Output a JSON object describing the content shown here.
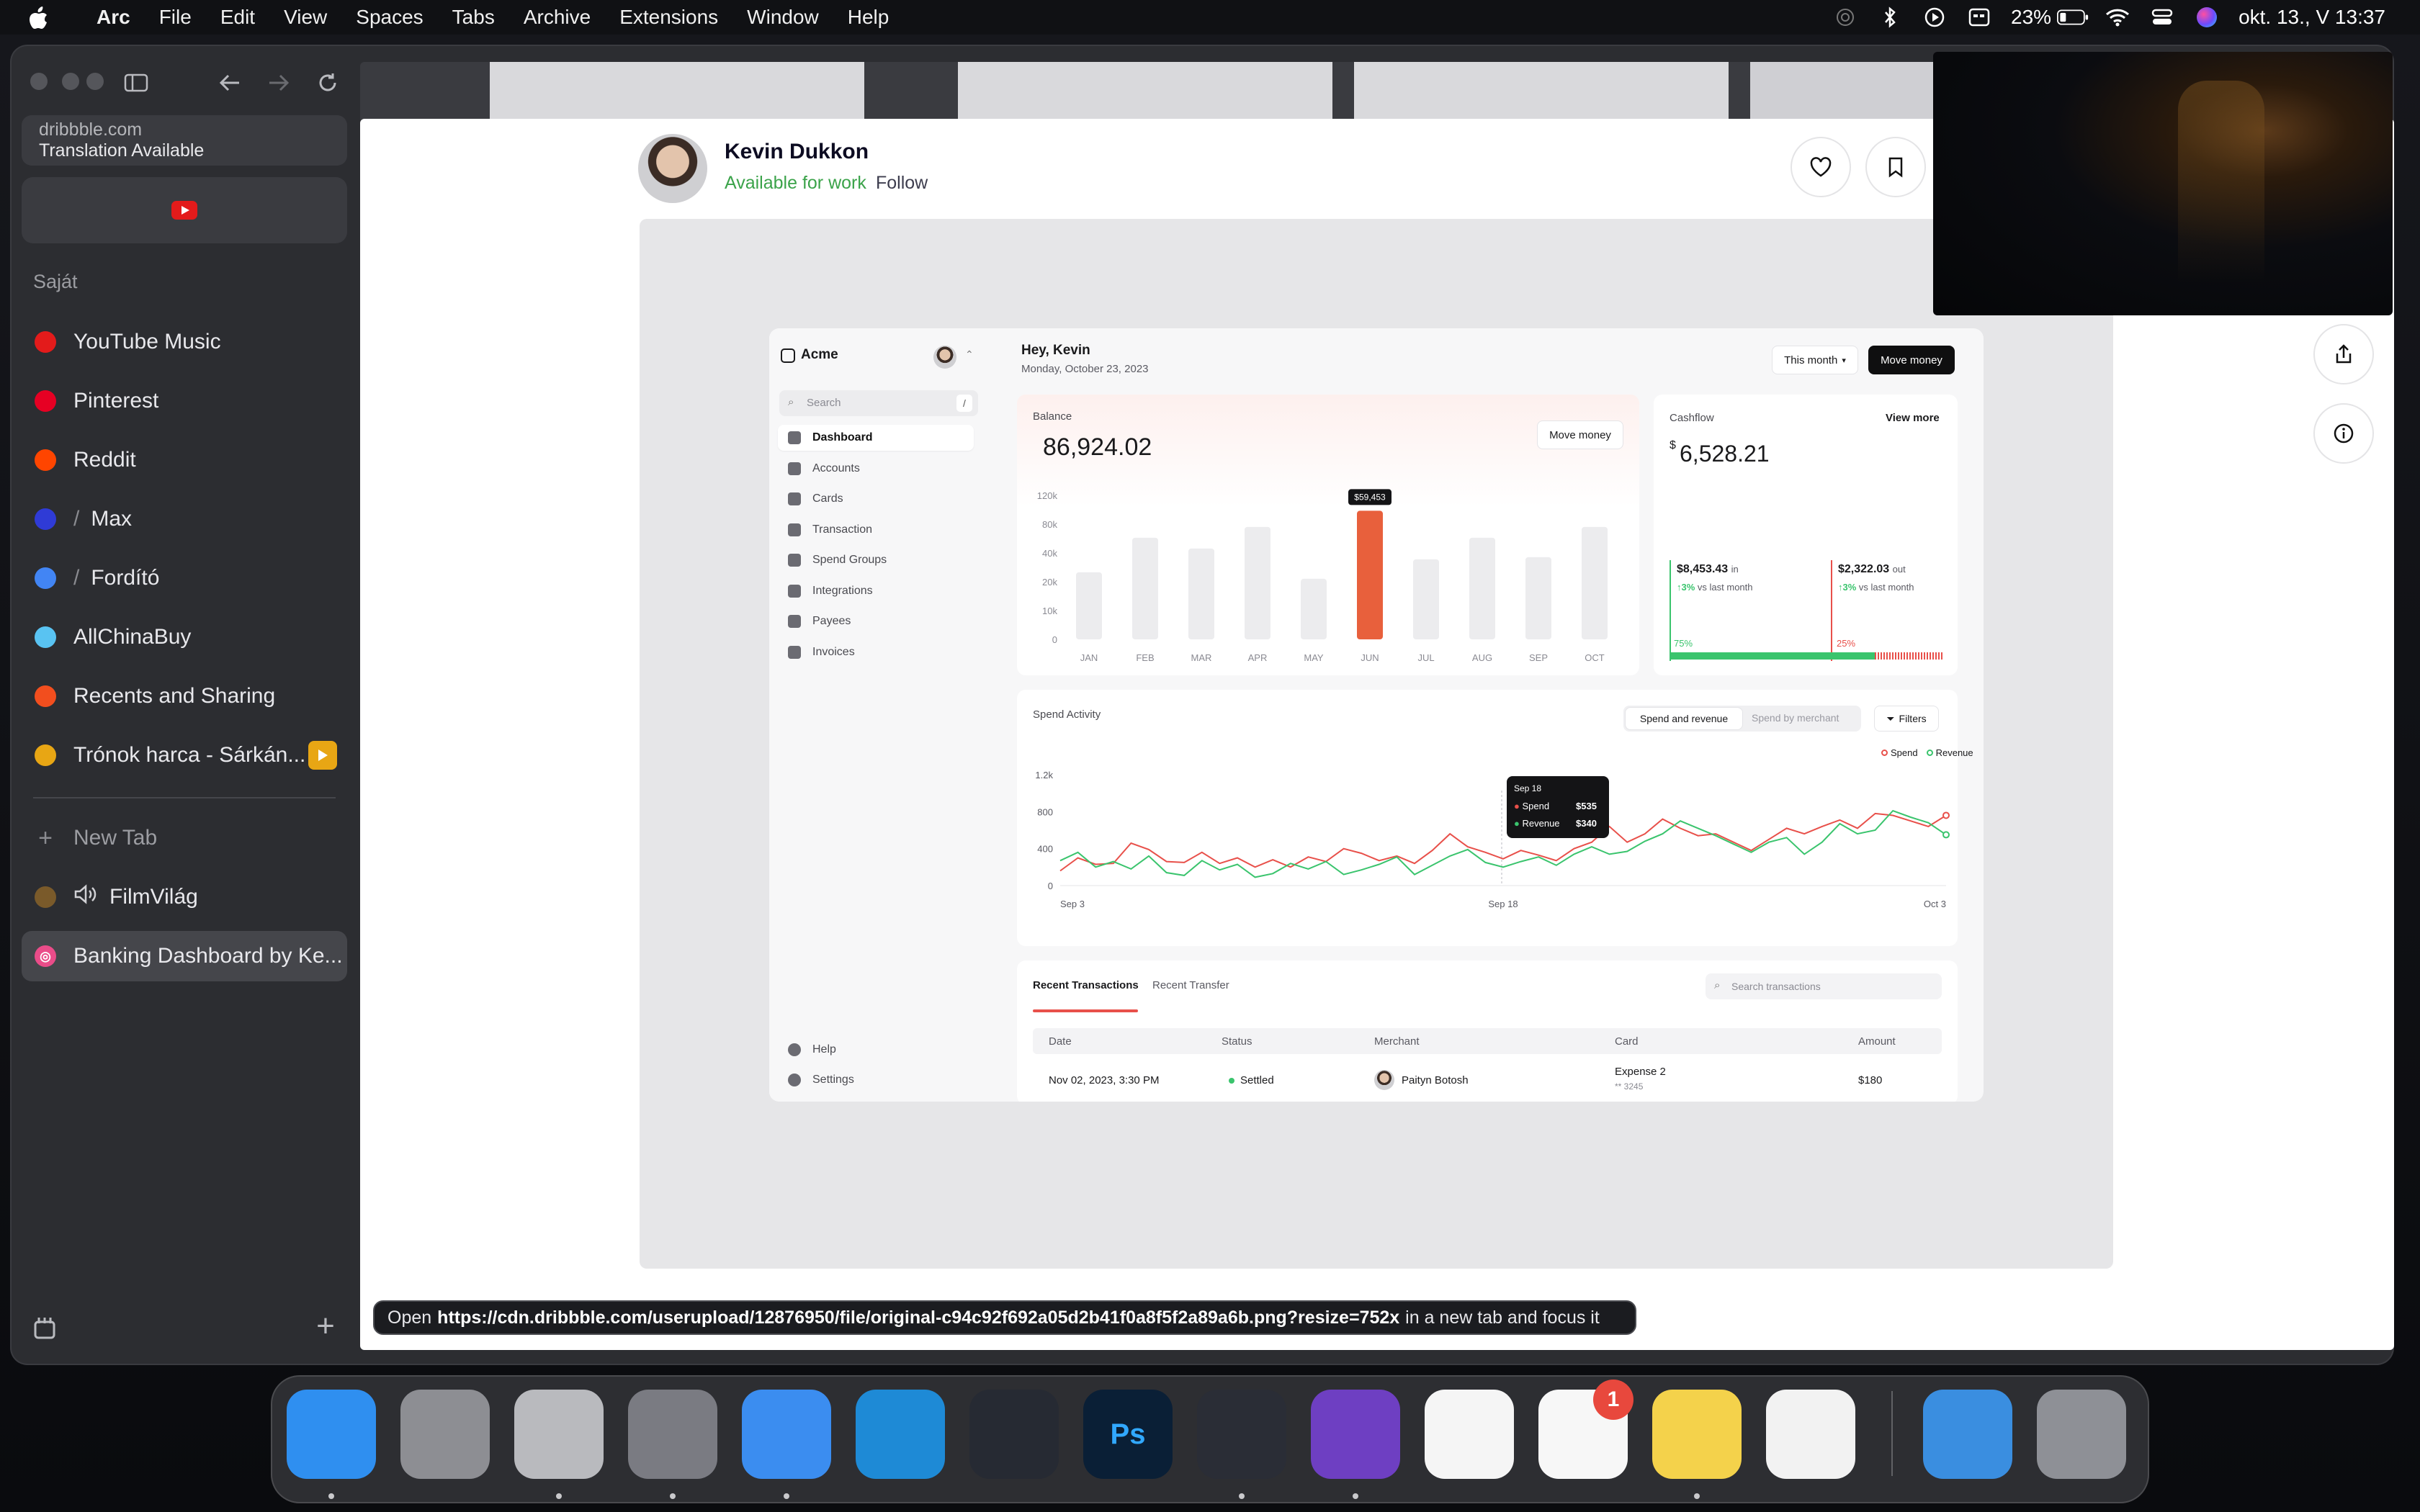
{
  "menubar": {
    "app_name": "Arc",
    "items": [
      "File",
      "Edit",
      "View",
      "Spaces",
      "Tabs",
      "Archive",
      "Extensions",
      "Window",
      "Help"
    ],
    "battery": "23%",
    "clock": "okt. 13., V  13:37"
  },
  "browser": {
    "url_domain": "dribbble.com",
    "url_notice": "Translation Available",
    "section_label": "Saját",
    "tabs": [
      {
        "label": "YouTube Music",
        "icon": "youtube-music-icon",
        "color": "#e31b1b"
      },
      {
        "label": "Pinterest",
        "icon": "pinterest-icon",
        "color": "#e60023"
      },
      {
        "label": "Reddit",
        "icon": "reddit-icon",
        "color": "#ff4500"
      },
      {
        "label": "Max",
        "icon": "max-icon",
        "color": "#2f3bd6"
      },
      {
        "label": "Fordító",
        "icon": "translate-icon",
        "color": "#4285f4"
      },
      {
        "label": "AllChinaBuy",
        "icon": "allchinabuy-icon",
        "color": "#59c3f2"
      },
      {
        "label": "Recents and Sharing",
        "icon": "figma-icon",
        "color": "#f24e1e"
      },
      {
        "label": "Trónok harca - Sárkán...",
        "icon": "play-icon",
        "color": "#e8a614"
      }
    ],
    "new_tab_label": "New Tab",
    "extra_tabs": [
      {
        "label": "FilmVilág",
        "icon": "filmvilag-icon"
      },
      {
        "label": "Banking Dashboard by Ke...",
        "icon": "dribbble-icon",
        "color": "#ea4c89"
      }
    ],
    "status_prefix": "Open",
    "status_url": "https://cdn.dribbble.com/userupload/12876950/file/original-c94c92f692a05d2b41f0a8f5f2a89a6b.png?resize=752x",
    "status_suffix": "in a new tab and focus it"
  },
  "shot": {
    "author": "Kevin Dukkon",
    "availability": "Available for work",
    "follow_label": "Follow"
  },
  "dashboard": {
    "brand": "Acme",
    "search_placeholder": "Search",
    "search_shortcut": "/",
    "nav": [
      "Dashboard",
      "Accounts",
      "Cards",
      "Transaction",
      "Spend Groups",
      "Integrations",
      "Payees",
      "Invoices"
    ],
    "nav_bottom": [
      "Help",
      "Settings"
    ],
    "greeting": "Hey, Kevin",
    "date": "Monday, October 23, 2023",
    "period_label": "This month",
    "move_money_label": "Move money",
    "balance": {
      "label": "Balance",
      "value": "86,924.02",
      "button": "Move money",
      "tooltip": "$59,453"
    },
    "cashflow": {
      "label": "Cashflow",
      "view_more": "View more",
      "currency": "$",
      "value": "6,528.21",
      "in_value": "$8,453.43",
      "in_label": "in",
      "in_change": "3%",
      "in_change_label": "vs last month",
      "out_value": "$2,322.03",
      "out_label": "out",
      "out_change": "3%",
      "out_change_label": "vs last month",
      "in_pct": "75%",
      "out_pct": "25%",
      "in_fraction": 0.75,
      "out_fraction": 0.25,
      "in_color": "#3ac46d",
      "out_color": "#e8504a"
    },
    "spend": {
      "title": "Spend Activity",
      "tab_active": "Spend and revenue",
      "tab_inactive": "Spend by merchant",
      "filters": "Filters",
      "legend_spend": "Spend",
      "legend_revenue": "Revenue",
      "tooltip_date": "Sep 18",
      "tooltip_spend_label": "Spend",
      "tooltip_spend": "$535",
      "tooltip_revenue_label": "Revenue",
      "tooltip_revenue": "$340"
    },
    "transactions": {
      "tab_active": "Recent Transactions",
      "tab_inactive": "Recent Transfer",
      "search_placeholder": "Search transactions",
      "columns": [
        "Date",
        "Status",
        "Merchant",
        "Card",
        "Amount"
      ],
      "rows": [
        {
          "date": "Nov 02, 2023,",
          "time": "3:30 PM",
          "status": "Settled",
          "merchant": "Paityn Botosh",
          "card": "Expense 2",
          "card_num": "** 3245",
          "amount": "$180"
        }
      ]
    }
  },
  "chart_data": [
    {
      "type": "bar",
      "title": "Balance",
      "categories": [
        "JAN",
        "FEB",
        "MAR",
        "APR",
        "MAY",
        "JUN",
        "JUL",
        "AUG",
        "SEP",
        "OCT"
      ],
      "values": [
        31000,
        47000,
        42000,
        52000,
        28000,
        59453,
        37000,
        47000,
        38000,
        52000
      ],
      "highlight": "JUN",
      "yticks": [
        "120k",
        "80k",
        "40k",
        "20k",
        "10k",
        "0"
      ],
      "grid": false
    },
    {
      "type": "line",
      "title": "Spend Activity",
      "x_start": "Sep 3",
      "x_mid": "Sep 18",
      "x_end": "Oct 3",
      "yticks": [
        "1.2k",
        "800",
        "400",
        "0"
      ],
      "ylim": [
        0,
        1200
      ],
      "legend": "top-right",
      "series": [
        {
          "name": "Spend",
          "color": "#e8504a",
          "values": [
            160,
            300,
            230,
            240,
            460,
            390,
            260,
            250,
            360,
            240,
            300,
            200,
            280,
            200,
            310,
            260,
            400,
            350,
            270,
            320,
            240,
            380,
            560,
            420,
            360,
            290,
            380,
            330,
            270,
            400,
            470,
            640,
            470,
            560,
            720,
            620,
            540,
            560,
            470,
            380,
            500,
            620,
            560,
            640,
            710,
            620,
            780,
            760,
            700,
            640,
            760
          ]
        },
        {
          "name": "Revenue",
          "color": "#3ac46d",
          "values": [
            270,
            360,
            200,
            260,
            180,
            320,
            140,
            110,
            270,
            170,
            230,
            90,
            130,
            240,
            180,
            260,
            120,
            170,
            230,
            310,
            120,
            220,
            320,
            390,
            250,
            200,
            260,
            310,
            220,
            340,
            420,
            340,
            370,
            480,
            560,
            700,
            620,
            540,
            450,
            360,
            470,
            520,
            340,
            470,
            670,
            560,
            600,
            810,
            740,
            680,
            550
          ]
        }
      ]
    }
  ],
  "dock": [
    {
      "name": "finder-icon",
      "color": "#2f8ff0"
    },
    {
      "name": "system-settings-icon",
      "color": "#8d8e93"
    },
    {
      "name": "launchpad-icon",
      "color": "#b9babe"
    },
    {
      "name": "arc-icon",
      "color": "#7a7b82"
    },
    {
      "name": "mail-icon",
      "color": "#3b8df0"
    },
    {
      "name": "vscode-icon",
      "color": "#1e8ad6"
    },
    {
      "name": "davinci-resolve-icon",
      "color": "#262a33"
    },
    {
      "name": "photoshop-icon",
      "color": "#0a1f36",
      "label": "Ps"
    },
    {
      "name": "blender-icon",
      "color": "#2a2d36"
    },
    {
      "name": "github-desktop-icon",
      "color": "#6e3fc2"
    },
    {
      "name": "photos-icon",
      "color": "#f5f5f5"
    },
    {
      "name": "reminders-icon",
      "color": "#f7f7f7",
      "badge": "1"
    },
    {
      "name": "notes-icon",
      "color": "#f4d24b"
    },
    {
      "name": "textedit-icon",
      "color": "#f2f2f2"
    },
    {
      "name": "downloads-folder-icon",
      "color": "#3a8ee0"
    },
    {
      "name": "trash-icon",
      "color": "#8e9096"
    }
  ]
}
